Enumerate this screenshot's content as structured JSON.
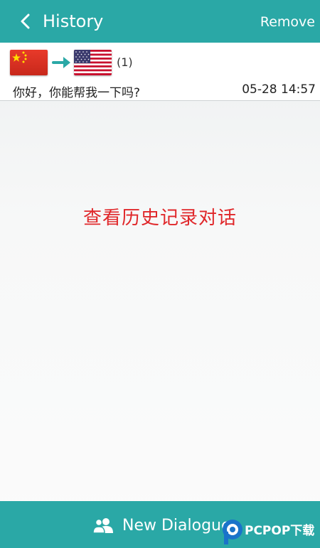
{
  "header": {
    "back_icon": "chevron-left-icon",
    "title": "History",
    "remove_label": "Remove"
  },
  "history_item": {
    "from_flag": "china-flag",
    "to_flag": "usa-flag",
    "count": "(1)",
    "message": "你好，你能帮我一下吗?",
    "timestamp": "05-28 14:57"
  },
  "caption": "查看历史记录对话",
  "footer": {
    "icon": "users-icon",
    "label": "New Dialogue"
  },
  "watermark": "PCPOP下载",
  "colors": {
    "accent": "#2aa8a6",
    "caption": "#e0272a"
  }
}
